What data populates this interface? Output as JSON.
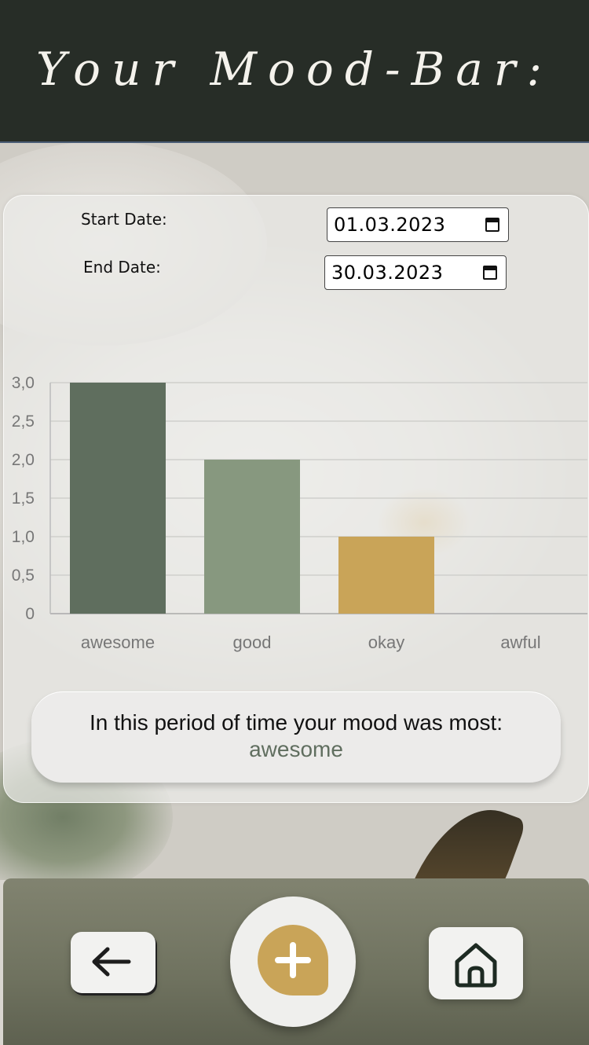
{
  "header": {
    "title": "Your Mood-Bar:"
  },
  "dates": {
    "start_label": "Start Date:",
    "start_value": "01.03.2023",
    "end_label": "End Date:",
    "end_value": "30.03.2023"
  },
  "chart_data": {
    "type": "bar",
    "categories": [
      "awesome",
      "good",
      "okay",
      "awful"
    ],
    "values": [
      3,
      2,
      1,
      0
    ],
    "colors": [
      "#5f6e5e",
      "#87987f",
      "#c9a458",
      "#999999"
    ],
    "ylim": [
      0,
      3
    ],
    "yticks": [
      "0",
      "0,5",
      "1,0",
      "1,5",
      "2,0",
      "2,5",
      "3,0"
    ],
    "ytick_values": [
      0,
      0.5,
      1,
      1.5,
      2,
      2.5,
      3
    ],
    "grid": true,
    "title": "",
    "xlabel": "",
    "ylabel": ""
  },
  "summary": {
    "text": "In this period of time your mood was most:",
    "mood": "awesome",
    "mood_color": "#606e5f"
  },
  "nav": {
    "back_icon": "arrow-left-icon",
    "add_icon": "plus-icon",
    "home_icon": "home-icon",
    "accent": "#c9a458"
  }
}
